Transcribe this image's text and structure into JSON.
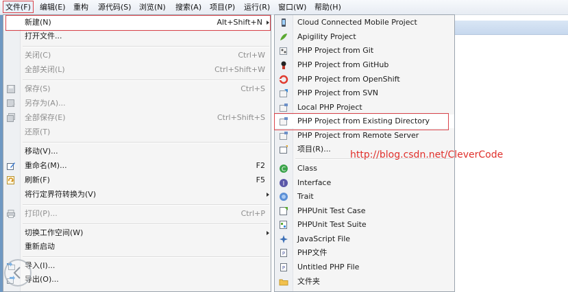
{
  "menubar": {
    "items": [
      {
        "label": "文件(F)"
      },
      {
        "label": "编辑(E)"
      },
      {
        "label": "重构"
      },
      {
        "label": "源代码(S)"
      },
      {
        "label": "浏览(N)"
      },
      {
        "label": "搜索(A)"
      },
      {
        "label": "项目(P)"
      },
      {
        "label": "运行(R)"
      },
      {
        "label": "窗口(W)"
      },
      {
        "label": "帮助(H)"
      }
    ]
  },
  "file_menu": {
    "new": {
      "label": "新建(N)",
      "shortcut": "Alt+Shift+N"
    },
    "open_file": {
      "label": "打开文件..."
    },
    "close": {
      "label": "关闭(C)",
      "shortcut": "Ctrl+W"
    },
    "close_all": {
      "label": "全部关闭(L)",
      "shortcut": "Ctrl+Shift+W"
    },
    "save": {
      "label": "保存(S)",
      "shortcut": "Ctrl+S"
    },
    "save_as": {
      "label": "另存为(A)..."
    },
    "save_all": {
      "label": "全部保存(E)",
      "shortcut": "Ctrl+Shift+S"
    },
    "revert": {
      "label": "还原(T)"
    },
    "move": {
      "label": "移动(V)..."
    },
    "rename": {
      "label": "重命名(M)...",
      "shortcut": "F2"
    },
    "refresh": {
      "label": "刷新(F)",
      "shortcut": "F5"
    },
    "convert_delimiters": {
      "label": "将行定界符转换为(V)"
    },
    "print": {
      "label": "打印(P)...",
      "shortcut": "Ctrl+P"
    },
    "switch_workspace": {
      "label": "切换工作空间(W)"
    },
    "restart": {
      "label": "重新启动"
    },
    "import": {
      "label": "导入(I)..."
    },
    "export": {
      "label": "导出(O)..."
    }
  },
  "new_submenu": {
    "items": [
      {
        "label": "Cloud Connected Mobile Project",
        "icon": "cloud-mobile-icon"
      },
      {
        "label": "Apigility Project",
        "icon": "apigility-icon"
      },
      {
        "label": "PHP Project from Git",
        "icon": "git-project-icon"
      },
      {
        "label": "PHP Project from GitHub",
        "icon": "github-icon"
      },
      {
        "label": "PHP Project from OpenShift",
        "icon": "openshift-icon"
      },
      {
        "label": "PHP Project from SVN",
        "icon": "svn-project-icon"
      },
      {
        "label": "Local PHP Project",
        "icon": "local-php-project-icon"
      },
      {
        "label": "PHP Project from Existing Directory",
        "icon": "existing-directory-icon"
      },
      {
        "label": "PHP Project from Remote Server",
        "icon": "remote-server-icon"
      },
      {
        "label": "项目(R)...",
        "icon": "project-icon"
      },
      {
        "label": "Class",
        "icon": "class-icon"
      },
      {
        "label": "Interface",
        "icon": "interface-icon"
      },
      {
        "label": "Trait",
        "icon": "trait-icon"
      },
      {
        "label": "PHPUnit Test Case",
        "icon": "phpunit-test-case-icon"
      },
      {
        "label": "PHPUnit Test Suite",
        "icon": "phpunit-test-suite-icon"
      },
      {
        "label": "JavaScript File",
        "icon": "javascript-file-icon"
      },
      {
        "label": "PHP文件",
        "icon": "php-file-icon"
      },
      {
        "label": "Untitled PHP File",
        "icon": "untitled-php-file-icon"
      },
      {
        "label": "文件夹",
        "icon": "folder-icon"
      }
    ]
  },
  "watermark": {
    "text": "http://blog.csdn.net/CleverCode"
  },
  "colors": {
    "highlight_border": "#d8434a",
    "watermark": "#e0302b"
  }
}
